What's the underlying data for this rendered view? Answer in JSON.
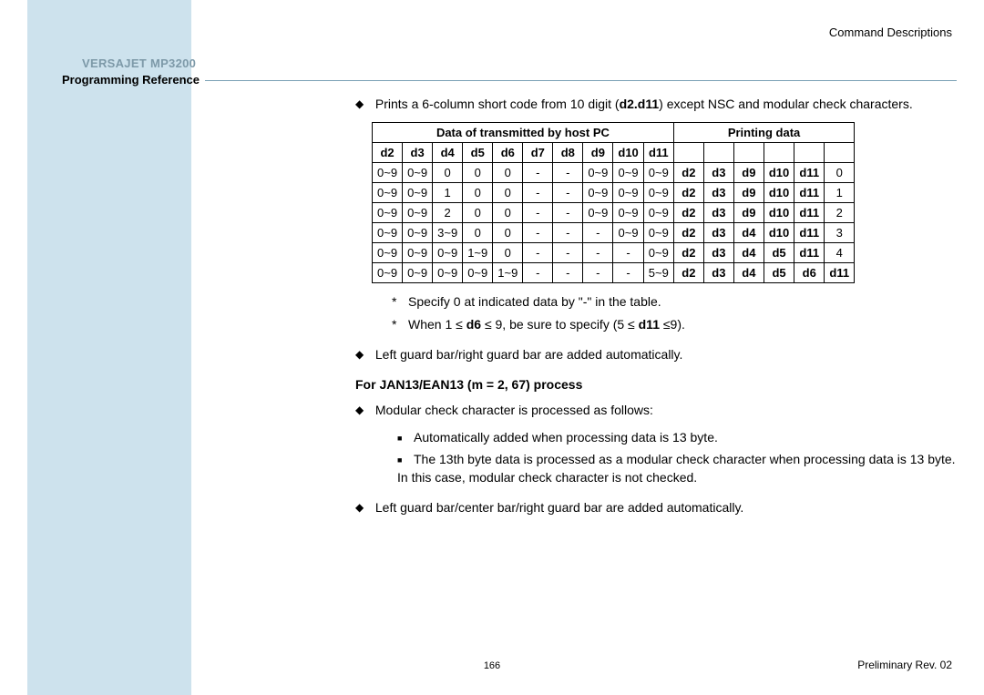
{
  "header_right": "Command Descriptions",
  "sidebar_title": "VERSAJET MP3200",
  "sidebar_sub": "Programming Reference",
  "bullet1_pre": "Prints a 6-column short code from 10 digit (",
  "bullet1_bold": "d2.d11",
  "bullet1_post": ") except NSC and modular check characters.",
  "table_h1": "Data of transmitted by host PC",
  "table_h2": "Printing data",
  "cols": [
    "d2",
    "d3",
    "d4",
    "d5",
    "d6",
    "d7",
    "d8",
    "d9",
    "d10",
    "d11",
    "",
    "",
    "",
    "",
    "",
    ""
  ],
  "rows": [
    [
      "0~9",
      "0~9",
      "0",
      "0",
      "0",
      "-",
      "-",
      "0~9",
      "0~9",
      "0~9",
      "d2",
      "d3",
      "d9",
      "d10",
      "d11",
      "0"
    ],
    [
      "0~9",
      "0~9",
      "1",
      "0",
      "0",
      "-",
      "-",
      "0~9",
      "0~9",
      "0~9",
      "d2",
      "d3",
      "d9",
      "d10",
      "d11",
      "1"
    ],
    [
      "0~9",
      "0~9",
      "2",
      "0",
      "0",
      "-",
      "-",
      "0~9",
      "0~9",
      "0~9",
      "d2",
      "d3",
      "d9",
      "d10",
      "d11",
      "2"
    ],
    [
      "0~9",
      "0~9",
      "3~9",
      "0",
      "0",
      "-",
      "-",
      "-",
      "0~9",
      "0~9",
      "d2",
      "d3",
      "d4",
      "d10",
      "d11",
      "3"
    ],
    [
      "0~9",
      "0~9",
      "0~9",
      "1~9",
      "0",
      "-",
      "-",
      "-",
      "-",
      "0~9",
      "d2",
      "d3",
      "d4",
      "d5",
      "d11",
      "4"
    ],
    [
      "0~9",
      "0~9",
      "0~9",
      "0~9",
      "1~9",
      "-",
      "-",
      "-",
      "-",
      "5~9",
      "d2",
      "d3",
      "d4",
      "d5",
      "d6",
      "d11"
    ]
  ],
  "note1": "Specify 0 at indicated data by \"-\" in the table.",
  "note2_pre": "When 1 ≤ ",
  "note2_b1": "d6",
  "note2_mid": " ≤ 9, be sure to specify (5 ≤ ",
  "note2_b2": "d11",
  "note2_post": " ≤9).",
  "bullet2": "Left guard bar/right guard bar are added automatically.",
  "subhead": "For JAN13/EAN13 (m = 2, 67) process",
  "bullet3": "Modular check character is processed as follows:",
  "inner1": "Automatically added when processing data is 13 byte.",
  "inner2": "The 13th byte data is processed as a modular check character when processing data is 13 byte. In this case, modular check character is not checked.",
  "bullet4": "Left guard bar/center bar/right guard bar are added automatically.",
  "pagenum": "166",
  "footer_right": "Preliminary Rev. 02"
}
